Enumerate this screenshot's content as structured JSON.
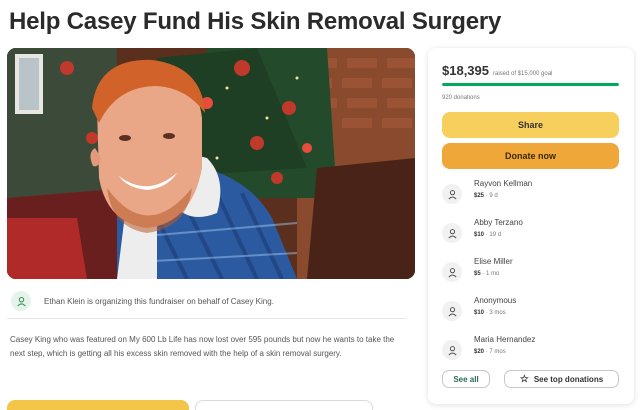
{
  "page": {
    "title": "Help Casey Fund His Skin Removal Surgery"
  },
  "organizer": {
    "text": "Ethan Klein is organizing this fundraiser on behalf of Casey King.",
    "icon": "person-icon"
  },
  "story": {
    "text": "Casey King who was featured on My 600 Lb Life has now lost over 595 pounds but now he wants to take the next step, which is getting all his excess skin removed with the help of a skin removal surgery."
  },
  "sidebar": {
    "raised": "$18,395",
    "goal_text": "raised of $15,000 goal",
    "progress_fraction": 1.0,
    "donations_count": "920 donations",
    "share_label": "Share",
    "donate_label": "Donate now",
    "donors": [
      {
        "name": "Rayvon Kellman",
        "amount": "$25",
        "time": "9 d"
      },
      {
        "name": "Abby Terzano",
        "amount": "$10",
        "time": "19 d"
      },
      {
        "name": "Elise Miller",
        "amount": "$5",
        "time": "1 mo"
      },
      {
        "name": "Anonymous",
        "amount": "$10",
        "time": "3 mos"
      },
      {
        "name": "Maria Hernandez",
        "amount": "$20",
        "time": "7 mos"
      }
    ],
    "separator": "·",
    "see_all_label": "See all",
    "top_donations_label": "See top donations"
  },
  "colors": {
    "progress": "#02a95c",
    "share": "#f7cf5c",
    "donate": "#f0a73a"
  }
}
